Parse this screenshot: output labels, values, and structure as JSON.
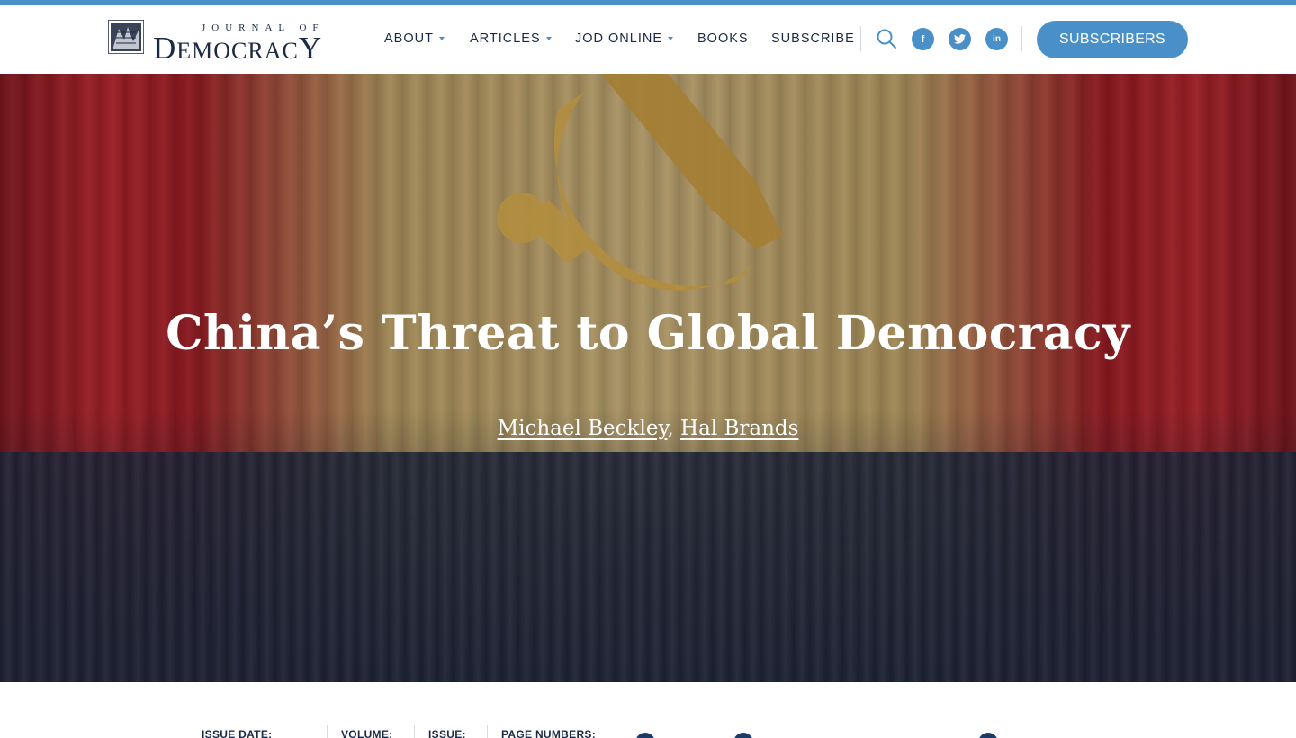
{
  "header": {
    "logo": {
      "small_text": "JOURNAL OF",
      "big_text_first": "D",
      "big_text_mid": "EMOCRAC",
      "big_text_last": "Y"
    },
    "nav": [
      {
        "label": "ABOUT",
        "has_dropdown": true
      },
      {
        "label": "ARTICLES",
        "has_dropdown": true
      },
      {
        "label": "JOD ONLINE",
        "has_dropdown": true
      },
      {
        "label": "BOOKS",
        "has_dropdown": false
      },
      {
        "label": "SUBSCRIBE",
        "has_dropdown": false
      }
    ],
    "icons": {
      "search": "search-icon",
      "facebook": "facebook-icon",
      "twitter": "twitter-icon",
      "linkedin": "linkedin-icon"
    },
    "social_glyphs": {
      "facebook": "f",
      "linkedin": "in"
    },
    "subscribers_button": "SUBSCRIBERS"
  },
  "hero": {
    "title": "China’s Threat to Global Democracy",
    "authors": [
      "Michael Beckley",
      "Hal Brands"
    ],
    "author_separator": ","
  },
  "meta": {
    "issue_date_label": "ISSUE DATE:",
    "volume_label": "VOLUME:",
    "issue_label": "ISSUE:",
    "page_numbers_label": "PAGE NUMBERS:"
  },
  "colors": {
    "accent": "#4a90c8",
    "navy": "#1b2a44",
    "curtain_red": "#c0272f",
    "emblem_gold": "#d8ad4e"
  }
}
